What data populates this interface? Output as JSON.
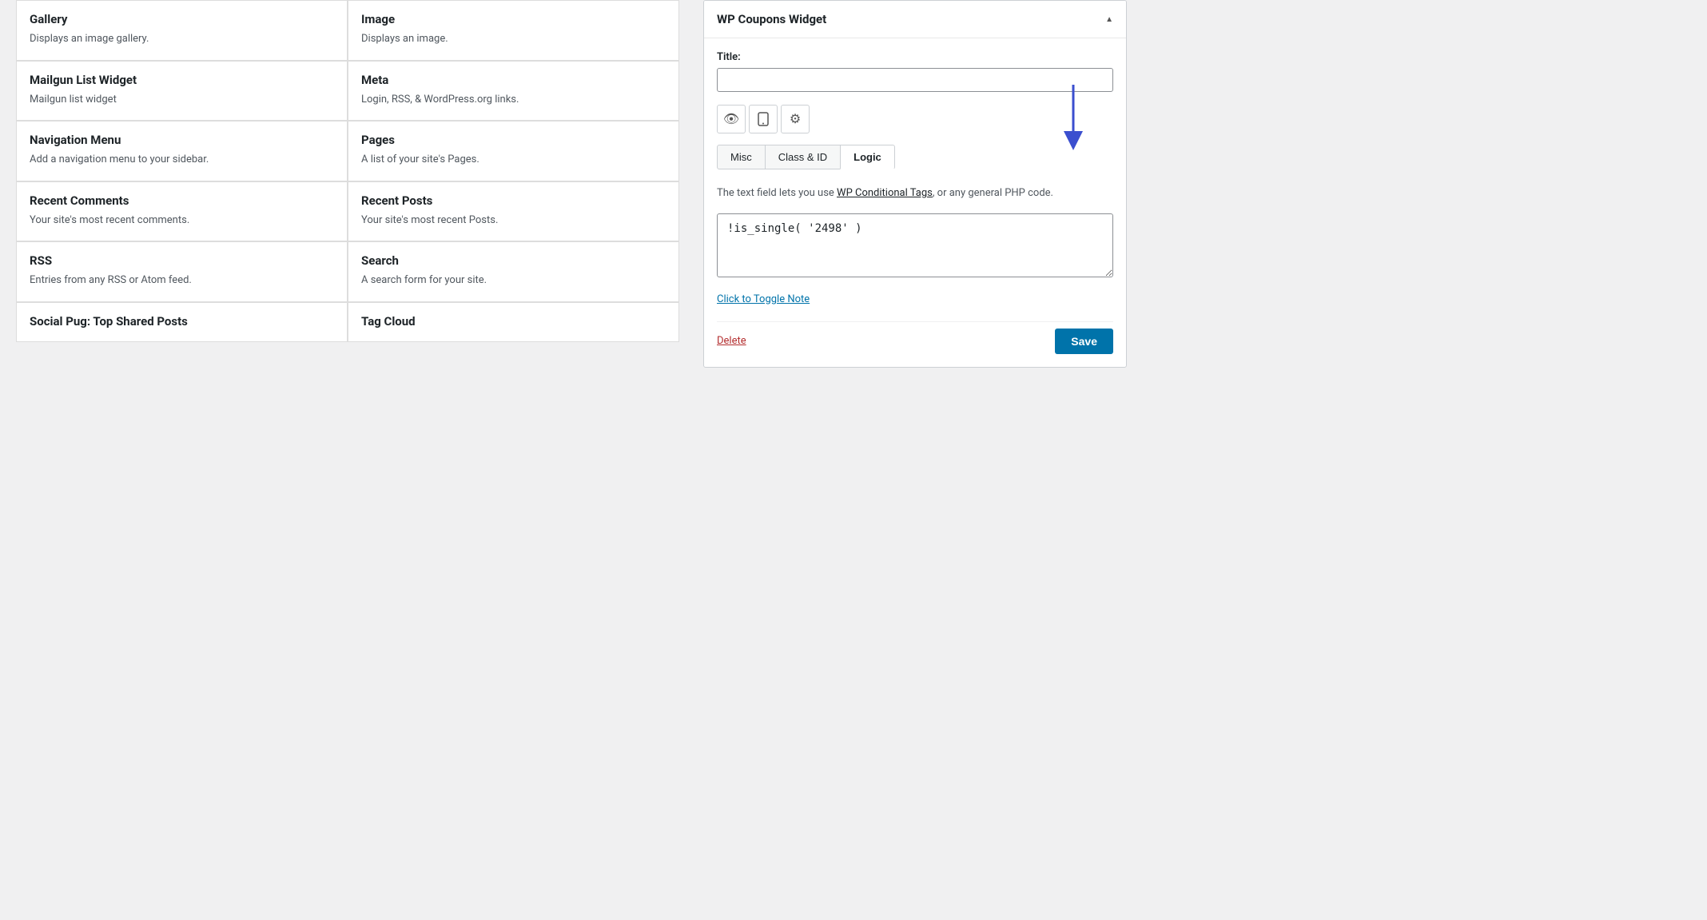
{
  "widgets": [
    {
      "col": 0,
      "name": "Gallery",
      "description": "Displays an image gallery."
    },
    {
      "col": 1,
      "name": "Image",
      "description": "Displays an image."
    },
    {
      "col": 0,
      "name": "Mailgun List Widget",
      "description": "Mailgun list widget"
    },
    {
      "col": 1,
      "name": "Meta",
      "description": "Login, RSS, & WordPress.org links."
    },
    {
      "col": 0,
      "name": "Navigation Menu",
      "description": "Add a navigation menu to your sidebar."
    },
    {
      "col": 1,
      "name": "Pages",
      "description": "A list of your site's Pages."
    },
    {
      "col": 0,
      "name": "Recent Comments",
      "description": "Your site's most recent comments."
    },
    {
      "col": 1,
      "name": "Recent Posts",
      "description": "Your site's most recent Posts."
    },
    {
      "col": 0,
      "name": "RSS",
      "description": "Entries from any RSS or Atom feed."
    },
    {
      "col": 1,
      "name": "Search",
      "description": "A search form for your site."
    },
    {
      "col": 0,
      "name": "Social Pug: Top Shared Posts",
      "description": ""
    },
    {
      "col": 1,
      "name": "Tag Cloud",
      "description": ""
    }
  ],
  "right_panel": {
    "title": "WP Coupons Widget",
    "collapse_icon": "▲",
    "title_label": "Title:",
    "title_value": "",
    "icons": [
      {
        "name": "eye-icon",
        "symbol": "👁"
      },
      {
        "name": "mobile-icon",
        "symbol": "📱"
      },
      {
        "name": "gear-icon",
        "symbol": "⚙"
      }
    ],
    "tabs": [
      {
        "id": "misc",
        "label": "Misc",
        "active": false
      },
      {
        "id": "class-id",
        "label": "Class & ID",
        "active": false
      },
      {
        "id": "logic",
        "label": "Logic",
        "active": true
      }
    ],
    "logic": {
      "description_start": "The text field lets you use ",
      "link_text": "WP Conditional Tags",
      "description_end": ", or any general PHP code.",
      "textarea_value": "!is_single( '2498' )",
      "toggle_note_label": "Click to Toggle Note",
      "delete_label": "Delete",
      "save_label": "Save"
    }
  }
}
